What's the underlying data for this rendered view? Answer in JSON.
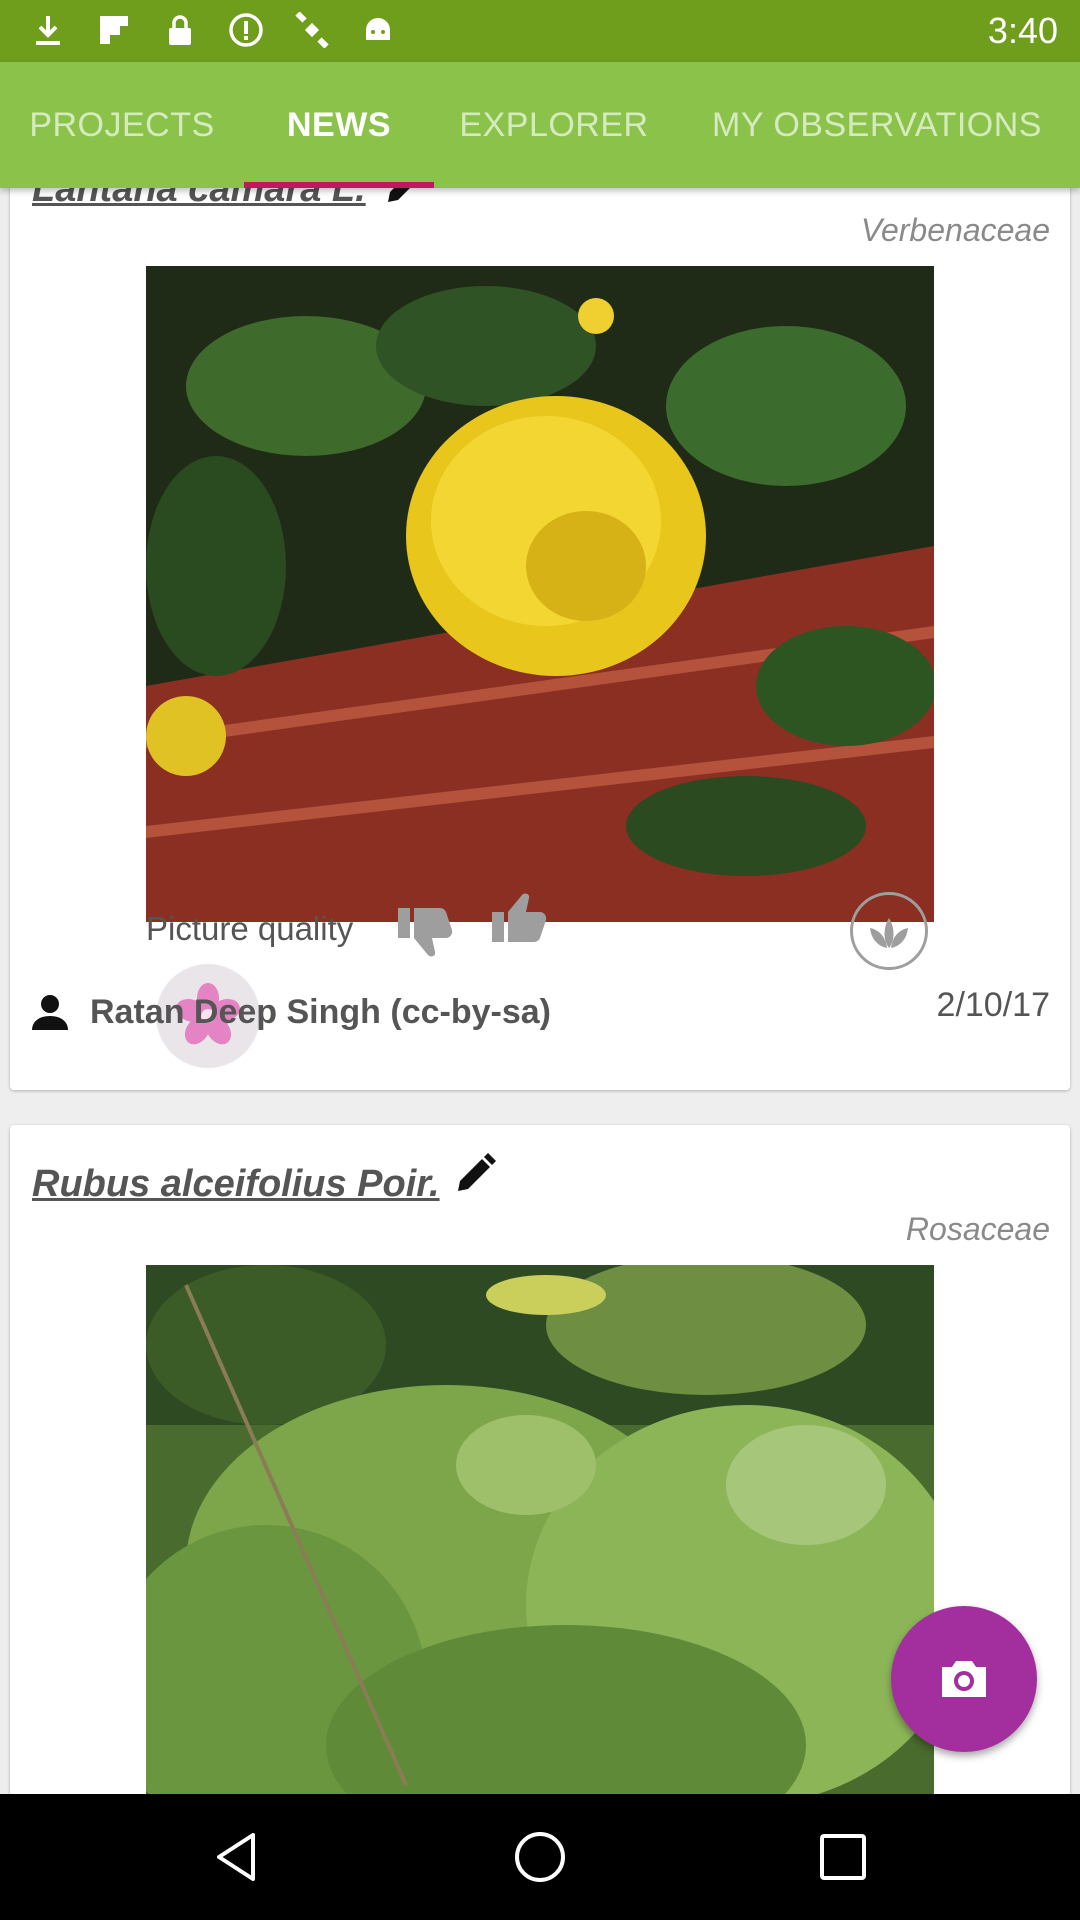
{
  "status_bar": {
    "time": "3:40",
    "icons": [
      "download-icon",
      "flipboard-icon",
      "lock-icon",
      "info-circle-icon",
      "satellite-icon",
      "android-icon"
    ]
  },
  "tabs": [
    {
      "label": "PROJECTS",
      "active": false
    },
    {
      "label": "NEWS",
      "active": true
    },
    {
      "label": "EXPLORER",
      "active": false
    },
    {
      "label": "MY OBSERVATIONS",
      "active": false
    }
  ],
  "cards": [
    {
      "species": "Lantana camara L.",
      "family": "Verbenaceae",
      "picture_quality_label": "Picture quality",
      "author": "Ratan Deep Singh (cc-by-sa)",
      "date": "2/10/17"
    },
    {
      "species": "Rubus alceifolius Poir.",
      "family": "Rosaceae"
    }
  ],
  "colors": {
    "status_bar": "#6f9d1c",
    "tab_bar": "#8bc34a",
    "tab_indicator": "#c2185b",
    "fab": "#a32e9e"
  },
  "fab": {
    "icon": "camera-icon"
  },
  "nav_bar": {
    "icons": [
      "back-icon",
      "home-icon",
      "recents-icon"
    ]
  }
}
